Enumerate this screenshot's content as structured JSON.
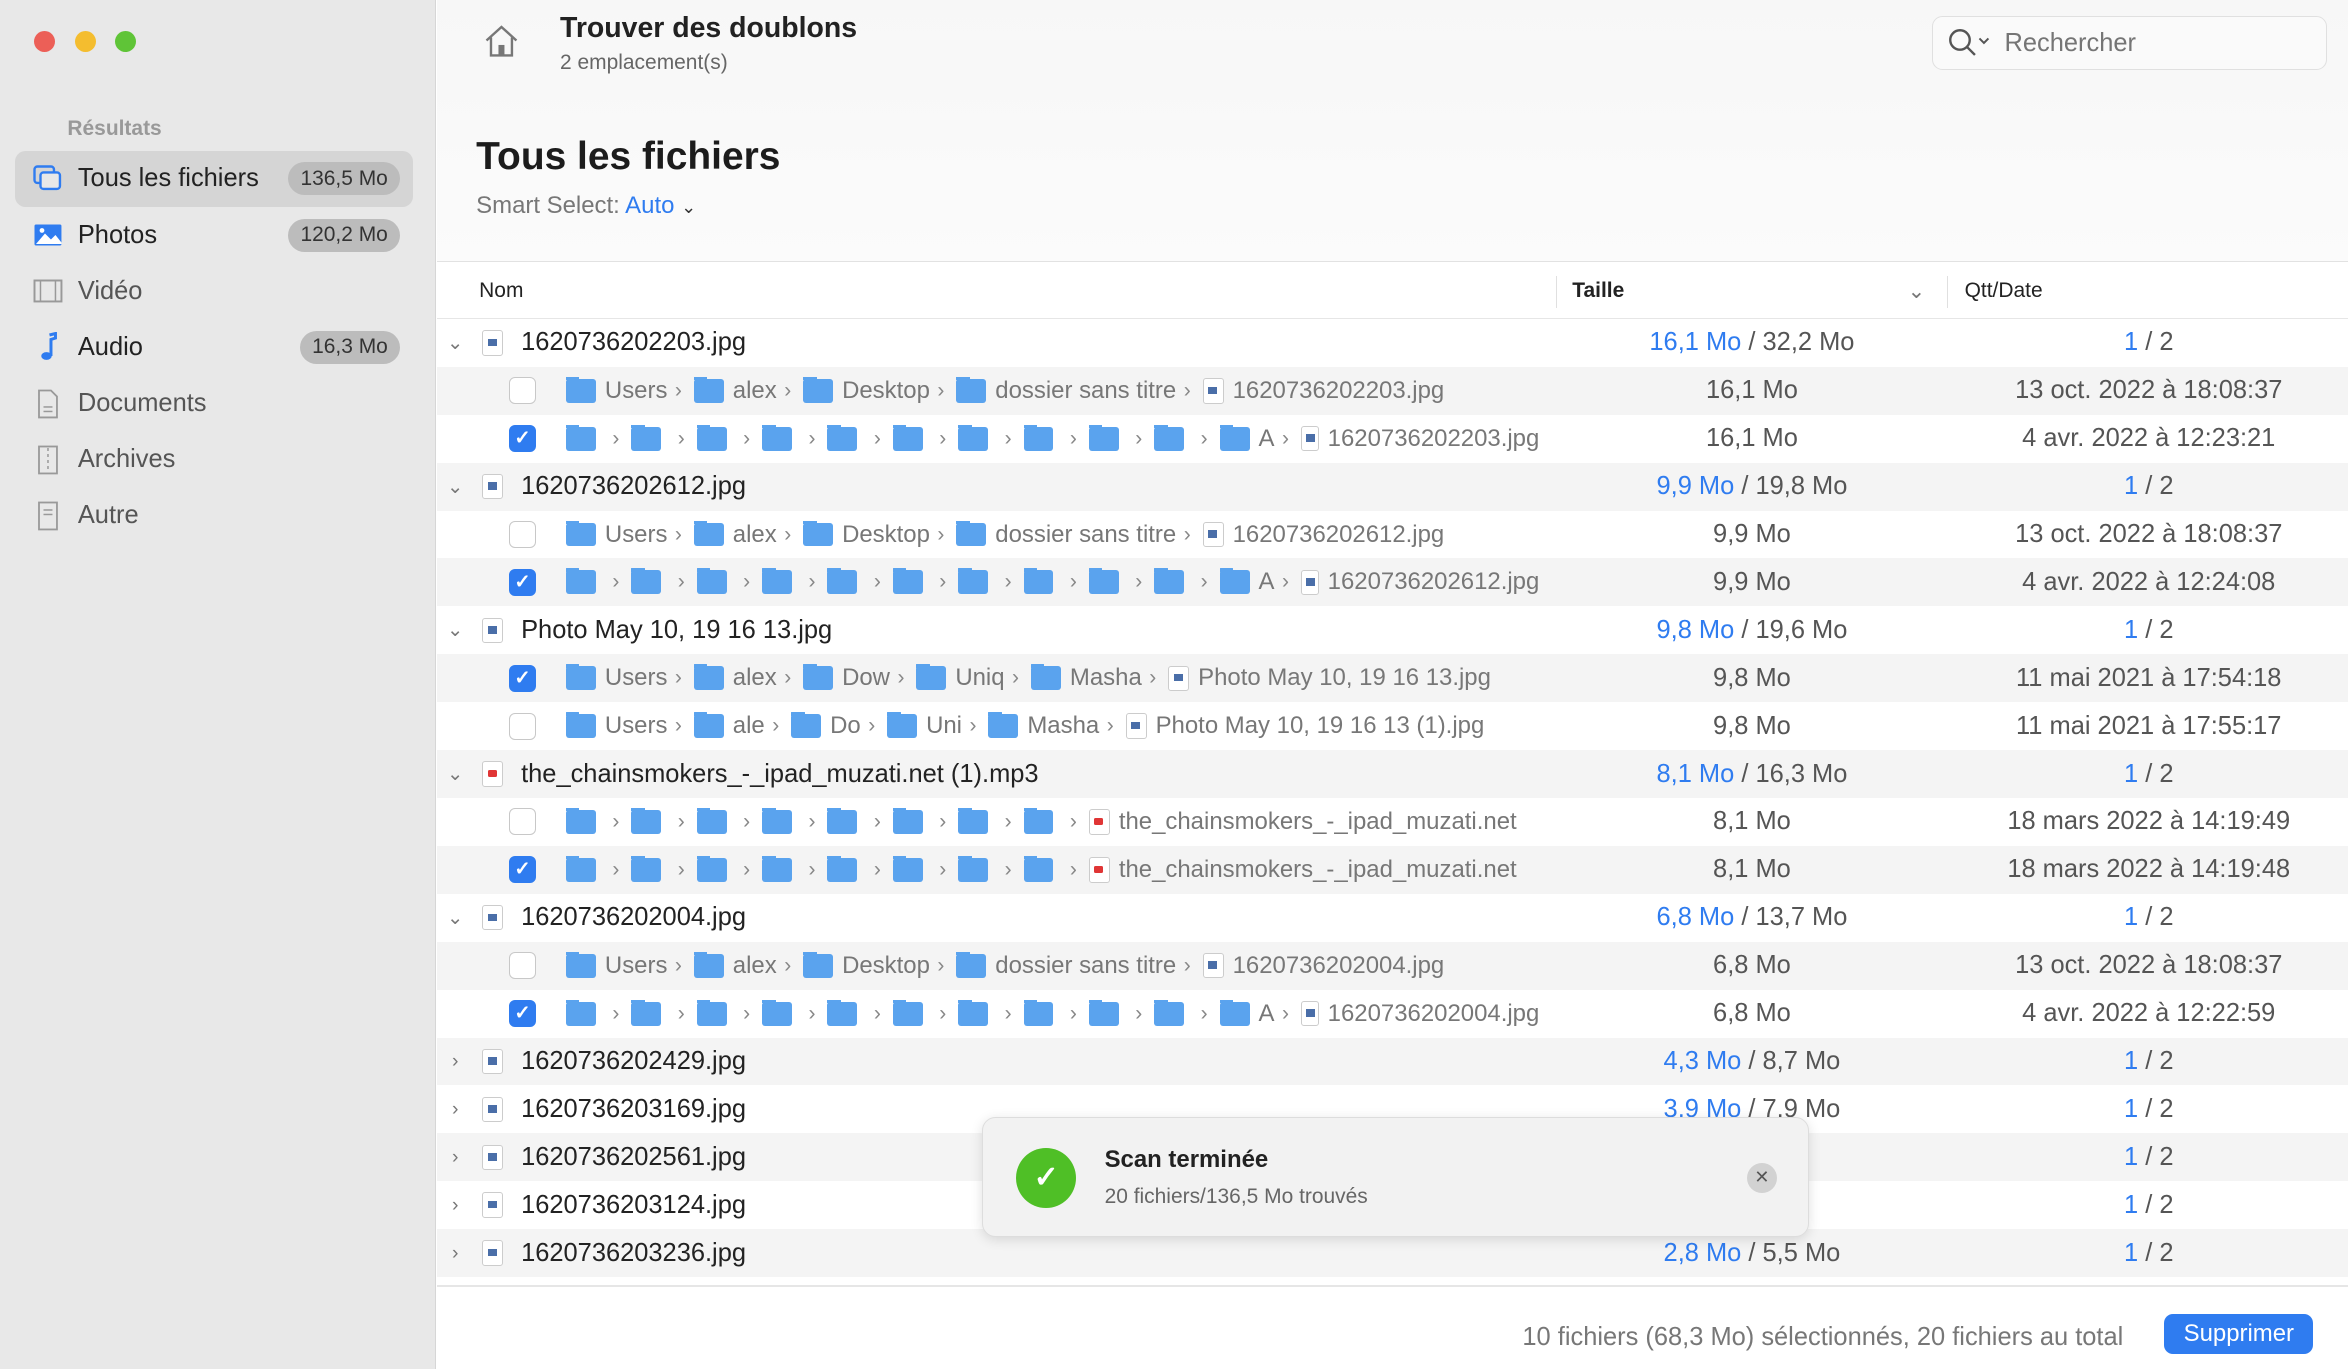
{
  "sidebar": {
    "section": "Résultats",
    "items": [
      {
        "label": "Tous les fichiers",
        "badge": "136,5 Mo",
        "icon": "files-icon",
        "active": true
      },
      {
        "label": "Photos",
        "badge": "120,2 Mo",
        "icon": "photo-icon"
      },
      {
        "label": "Vidéo",
        "badge": "",
        "icon": "film-icon"
      },
      {
        "label": "Audio",
        "badge": "16,3 Mo",
        "icon": "music-note-icon"
      },
      {
        "label": "Documents",
        "badge": "",
        "icon": "document-icon"
      },
      {
        "label": "Archives",
        "badge": "",
        "icon": "archive-icon"
      },
      {
        "label": "Autre",
        "badge": "",
        "icon": "other-file-icon"
      }
    ]
  },
  "header": {
    "title": "Trouver des doublons",
    "subtitle": "2 emplacement(s)",
    "search_placeholder": "Rechercher"
  },
  "main": {
    "title": "Tous les fichiers",
    "smart_select_label": "Smart Select:",
    "smart_select_value": "Auto"
  },
  "columns": {
    "name": "Nom",
    "size": "Taille",
    "qty": "Qtt/Date"
  },
  "groups": [
    {
      "name": "1620736202203.jpg",
      "type": "jpg",
      "expanded": true,
      "size_sel": "16,1 Mo",
      "size_total": "32,2 Mo",
      "qty_sel": "1",
      "qty_total": "2",
      "children": [
        {
          "checked": false,
          "path": [
            "Users",
            "alex",
            "Desktop",
            "dossier sans titre"
          ],
          "file": "1620736202203.jpg",
          "size": "16,1 Mo",
          "date": "13 oct. 2022 à 18:08:37"
        },
        {
          "checked": true,
          "path": [
            "",
            "",
            "",
            "",
            "",
            "",
            "",
            "",
            "",
            "",
            "A"
          ],
          "file": "1620736202203.jpg",
          "size": "16,1 Mo",
          "date": "4 avr. 2022 à 12:23:21"
        }
      ]
    },
    {
      "name": "1620736202612.jpg",
      "type": "jpg",
      "expanded": true,
      "size_sel": "9,9 Mo",
      "size_total": "19,8 Mo",
      "qty_sel": "1",
      "qty_total": "2",
      "children": [
        {
          "checked": false,
          "path": [
            "Users",
            "alex",
            "Desktop",
            "dossier sans titre"
          ],
          "file": "1620736202612.jpg",
          "size": "9,9 Mo",
          "date": "13 oct. 2022 à 18:08:37"
        },
        {
          "checked": true,
          "path": [
            "",
            "",
            "",
            "",
            "",
            "",
            "",
            "",
            "",
            "",
            "A"
          ],
          "file": "1620736202612.jpg",
          "size": "9,9 Mo",
          "date": "4 avr. 2022 à 12:24:08"
        }
      ]
    },
    {
      "name": "Photo May 10, 19 16 13.jpg",
      "type": "jpg",
      "expanded": true,
      "size_sel": "9,8 Mo",
      "size_total": "19,6 Mo",
      "qty_sel": "1",
      "qty_total": "2",
      "children": [
        {
          "checked": true,
          "path": [
            "Users",
            "alex",
            "Dow",
            "Uniq",
            "Masha"
          ],
          "file": "Photo May 10, 19 16 13.jpg",
          "size": "9,8 Mo",
          "date": "11 mai 2021 à 17:54:18"
        },
        {
          "checked": false,
          "path": [
            "Users",
            "ale",
            "Do",
            "Uni",
            "Masha"
          ],
          "file": "Photo May 10, 19 16 13 (1).jpg",
          "size": "9,8 Mo",
          "date": "11 mai 2021 à 17:55:17"
        }
      ]
    },
    {
      "name": "the_chainsmokers_-_ipad_muzati.net (1).mp3",
      "type": "mp3",
      "expanded": true,
      "size_sel": "8,1 Mo",
      "size_total": "16,3 Mo",
      "qty_sel": "1",
      "qty_total": "2",
      "children": [
        {
          "checked": false,
          "path": [
            "",
            "",
            "",
            "",
            "",
            "",
            "",
            ""
          ],
          "file": "the_chainsmokers_-_ipad_muzati.net",
          "size": "8,1 Mo",
          "date": "18 mars 2022 à 14:19:49"
        },
        {
          "checked": true,
          "path": [
            "",
            "",
            "",
            "",
            "",
            "",
            "",
            ""
          ],
          "file": "the_chainsmokers_-_ipad_muzati.net",
          "size": "8,1 Mo",
          "date": "18 mars 2022 à 14:19:48"
        }
      ]
    },
    {
      "name": "1620736202004.jpg",
      "type": "jpg",
      "expanded": true,
      "size_sel": "6,8 Mo",
      "size_total": "13,7 Mo",
      "qty_sel": "1",
      "qty_total": "2",
      "children": [
        {
          "checked": false,
          "path": [
            "Users",
            "alex",
            "Desktop",
            "dossier sans titre"
          ],
          "file": "1620736202004.jpg",
          "size": "6,8 Mo",
          "date": "13 oct. 2022 à 18:08:37"
        },
        {
          "checked": true,
          "path": [
            "",
            "",
            "",
            "",
            "",
            "",
            "",
            "",
            "",
            "",
            "A"
          ],
          "file": "1620736202004.jpg",
          "size": "6,8 Mo",
          "date": "4 avr. 2022 à 12:22:59"
        }
      ]
    },
    {
      "name": "1620736202429.jpg",
      "type": "jpg",
      "expanded": false,
      "size_sel": "4,3 Mo",
      "size_total": "8,7 Mo",
      "qty_sel": "1",
      "qty_total": "2",
      "children": []
    },
    {
      "name": "1620736203169.jpg",
      "type": "jpg",
      "expanded": false,
      "size_sel": "3,9 Mo",
      "size_total": "7,9 Mo",
      "qty_sel": "1",
      "qty_total": "2",
      "children": []
    },
    {
      "name": "1620736202561.jpg",
      "type": "jpg",
      "expanded": false,
      "size_sel": "",
      "size_total": "Mo",
      "qty_sel": "1",
      "qty_total": "2",
      "children": []
    },
    {
      "name": "1620736203124.jpg",
      "type": "jpg",
      "expanded": false,
      "size_sel": "",
      "size_total": "Mo",
      "qty_sel": "1",
      "qty_total": "2",
      "children": []
    },
    {
      "name": "1620736203236.jpg",
      "type": "jpg",
      "expanded": false,
      "size_sel": "2,8 Mo",
      "size_total": "5,5 Mo",
      "qty_sel": "1",
      "qty_total": "2",
      "children": []
    }
  ],
  "toast": {
    "title": "Scan terminée",
    "message": "20 fichiers/136,5 Mo trouvés"
  },
  "footer": {
    "status": "10 fichiers (68,3 Mo) sélectionnés, 20 fichiers au total",
    "delete_label": "Supprimer"
  },
  "colors": {
    "accent": "#2f7cf0",
    "success": "#4fbf26",
    "folder": "#5aa3ee"
  }
}
